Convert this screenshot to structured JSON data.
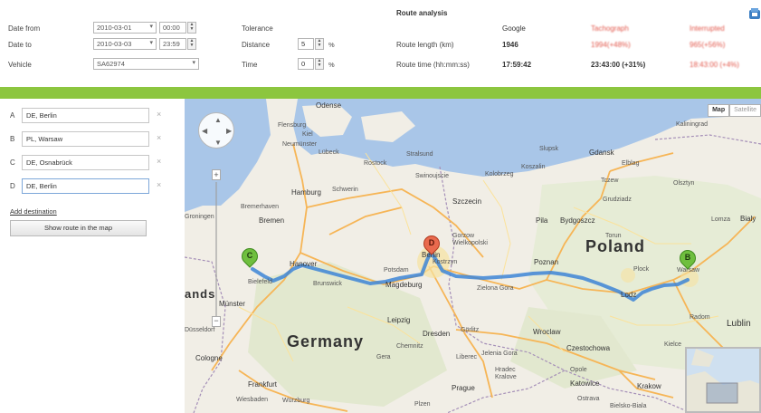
{
  "filters": {
    "date_from_label": "Date from",
    "date_from_value": "2010-03-01",
    "date_from_time": "00:00",
    "date_to_label": "Date to",
    "date_to_value": "2010-03-03",
    "date_to_time": "23:59",
    "vehicle_label": "Vehicle",
    "vehicle_value": "SA62974"
  },
  "tolerance": {
    "title": "Tolerance",
    "distance_label": "Distance",
    "distance_value": "5",
    "time_label": "Time",
    "time_value": "0",
    "percent": "%"
  },
  "route_analysis": {
    "title": "Route analysis",
    "col_google": "Google",
    "col_tachograph": "Tachograph",
    "col_interrupted": "Interrupted",
    "length_label": "Route length (km)",
    "time_label": "Route time (hh:mm:ss)",
    "google_length": "1946",
    "google_time": "17:59:42",
    "tacho_length": "1994(+48%)",
    "tacho_time": "23:43:00 (+31%)",
    "interrupted_length": "965(+56%)",
    "interrupted_time": "18:43:00 (+4%)"
  },
  "destinations": [
    {
      "letter": "A",
      "value": "DE, Berlin"
    },
    {
      "letter": "B",
      "value": "PL, Warsaw"
    },
    {
      "letter": "C",
      "value": "DE, Osnabrück"
    },
    {
      "letter": "D",
      "value": "DE, Berlin"
    }
  ],
  "sidebar": {
    "add_destination": "Add destination",
    "show_route_button": "Show route in the map"
  },
  "map": {
    "map_type_map": "Map",
    "map_type_satellite": "Satellite",
    "labels": {
      "odense": "Odense",
      "flensburg": "Flensburg",
      "kiel": "Kiel",
      "stralsund": "Stralsund",
      "neumunster": "Neumünster",
      "lubeck": "Lübeck",
      "rostock": "Rostock",
      "hamburg": "Hamburg",
      "schwerin": "Schwerin",
      "bremerhaven": "Bremerhaven",
      "bremen": "Bremen",
      "szczecin": "Szczecin",
      "swinoujscie": "Swinoujscie",
      "kolobrzeg": "Kolobrzeg",
      "koszalin": "Koszalin",
      "slupsk": "Slupsk",
      "gdansk": "Gdansk",
      "elblag": "Elblag",
      "kaliningrad": "Kaliningrad",
      "olsztyn": "Olsztyn",
      "tczew": "Tczew",
      "grudziadz": "Grudziadz",
      "pila": "Pila",
      "bydgoszcz": "Bydgoszcz",
      "torun": "Torun",
      "lomza": "Lomza",
      "bialystok": "Bialy",
      "hannover": "Hanover",
      "berlin": "Berlin",
      "potsdam": "Potsdam",
      "brunswick": "Brunswick",
      "magdeburg": "Magdeburg",
      "bielefeld": "Bielefeld",
      "munster": "Münster",
      "gorzow": "Gorzow Wielkopolski",
      "poznan": "Poznan",
      "zielona": "Zielona Gora",
      "plock": "Plock",
      "warsaw": "Warsaw",
      "lodz": "Lodz",
      "radom": "Radom",
      "lublin": "Lublin",
      "leipzig": "Leipzig",
      "dresden": "Dresden",
      "chemnitz": "Chemnitz",
      "gera": "Gera",
      "wroclaw": "Wroclaw",
      "czestochowa": "Czestochowa",
      "kielce": "Kielce",
      "opole": "Opole",
      "katowice": "Katowice",
      "krakow": "Krakow",
      "ostrava": "Ostrava",
      "prague": "Prague",
      "hradec": "Hradec Kralove",
      "frankfurt": "Frankfurt",
      "wurzburg": "Würzburg",
      "wiesbaden": "Wiesbaden",
      "cologne": "Cologne",
      "dusseldorf": "Düsseldorf",
      "germany": "Germany",
      "poland": "Poland",
      "lands": "ands",
      "groningen": "Groningen",
      "pizen": "Plzen",
      "jelenia": "Jelenia Gora",
      "liberec": "Liberec",
      "gorlitz": "Görlitz",
      "bielsko": "Bielsko-Biala",
      "kostrzyn": "Kostrzyn"
    },
    "markers": {
      "b": "B",
      "c": "C",
      "d": "D"
    },
    "route_color": "#3d85d6"
  }
}
